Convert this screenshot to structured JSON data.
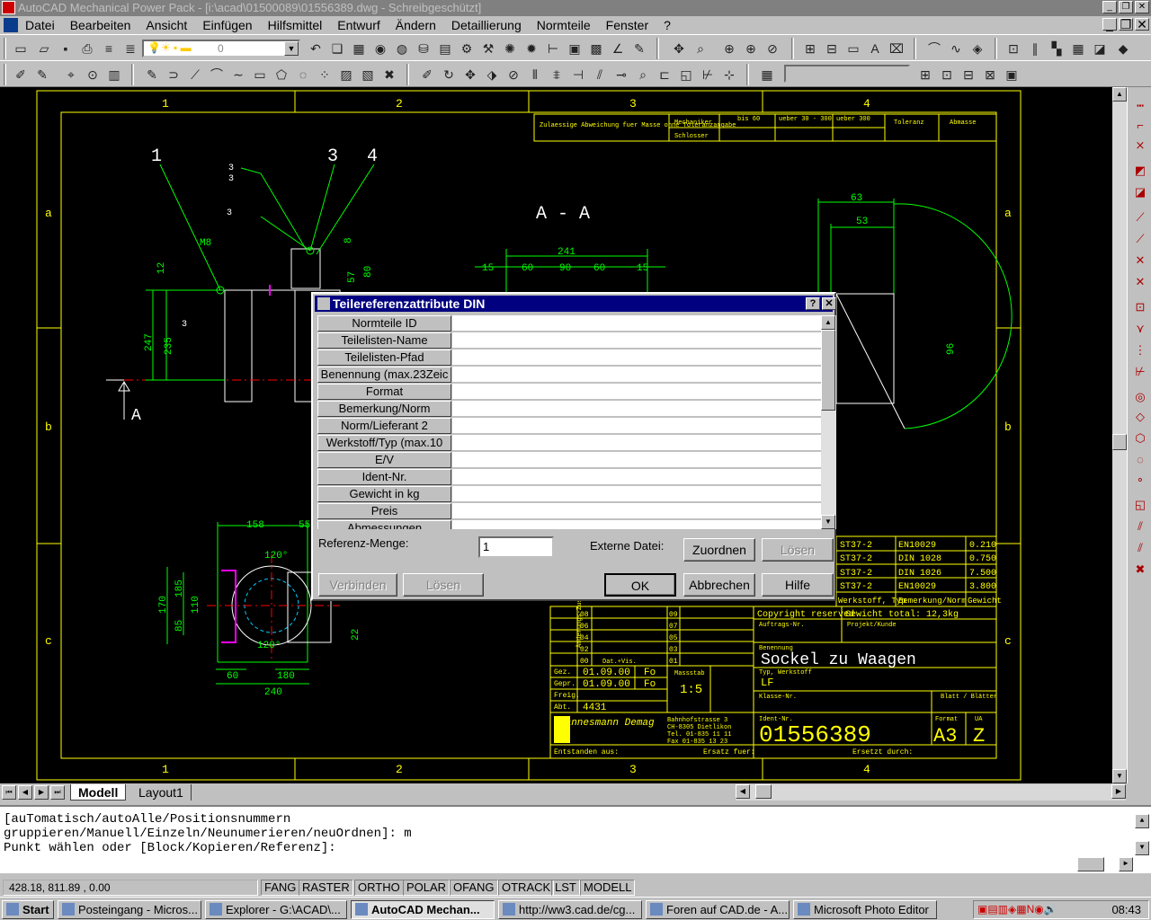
{
  "window": {
    "title": "AutoCAD Mechanical Power Pack - [i:\\acad\\01500089\\01556389.dwg - Schreibgeschützt]"
  },
  "menu": [
    "Datei",
    "Bearbeiten",
    "Ansicht",
    "Einfügen",
    "Hilfsmittel",
    "Entwurf",
    "Ändern",
    "Detaillierung",
    "Normteile",
    "Fenster",
    "?"
  ],
  "layer": {
    "value": "0"
  },
  "drawing": {
    "col_numbers": [
      "1",
      "2",
      "3",
      "4"
    ],
    "row_letters": [
      "a",
      "b",
      "c"
    ],
    "section_title": "A - A",
    "tolerance_header": [
      "Zulaessige Abweichung fuer Masse ohne Toleranzangabe",
      "Mechaniker",
      "Schlosser",
      "bis 60",
      "ueber 30 - 300",
      "ueber 300",
      "Toleranz",
      "Abmasse"
    ],
    "dims": [
      "M8",
      "12",
      "247",
      "235",
      "57",
      "80",
      "8",
      "241",
      "15",
      "60",
      "90",
      "60",
      "15",
      "63",
      "53",
      "96",
      "158",
      "55",
      "185",
      "170",
      "110",
      "85",
      "60",
      "180",
      "240",
      "22"
    ],
    "balloons": [
      "1",
      "3",
      "4"
    ],
    "bom": [
      [
        "ST37-2",
        "EN10029",
        "0.210"
      ],
      [
        "ST37-2",
        "DIN 1028",
        "0.750"
      ],
      [
        "ST37-2",
        "DIN 1026",
        "7.500"
      ],
      [
        "ST37-2",
        "EN10029",
        "3.800"
      ]
    ],
    "bom_header": [
      "Werkstoff, Typ",
      "Bemerkung/Norm",
      "Gewicht"
    ],
    "copyright": "Copyright reserved",
    "weight": "Gewicht total: 12,3kg",
    "auftrags": "Auftrags-Nr.",
    "projekt": "Projekt/Kunde",
    "benennung_label": "Benennung",
    "title": "Sockel zu Waagen",
    "typ_label": "Typ, Werkstoff",
    "typ": "LF",
    "klasse": "Klasse-Nr.",
    "blatt": "Blatt / Blätter",
    "ident_label": "Ident-Nr.",
    "ident": "01556389",
    "format_label": "Format",
    "format": "A3",
    "ua_label": "UA",
    "ua": "Z",
    "scale_label": "Massstab",
    "scale": "1:5",
    "company": "Mannesmann Demag",
    "address": [
      "Bahnhofstrasse 3",
      "CH-8305 Dietlikon",
      "Tel. 01-835 11 11",
      "Fax 01-835 13 23"
    ],
    "rev_label": "Änderungs-Zustand",
    "rev_rows": [
      "09",
      "08",
      "07",
      "06",
      "05",
      "04",
      "03",
      "02",
      "01",
      "00"
    ],
    "rev00": "Dat.+Vis.",
    "gez": "Gez.",
    "gepr": "Gepr.",
    "freig": "Freig.",
    "abt": "Abt.",
    "date1": "01.09.00",
    "date2": "01.09.00",
    "vis1": "Fo",
    "vis2": "Fo",
    "abt_val": "4431",
    "entstanden": "Entstanden aus:",
    "ersatz": "Ersatz fuer:",
    "ersetzt": "Ersetzt durch:"
  },
  "dialog": {
    "title": "Teilereferenzattribute DIN",
    "fields": [
      "Normteile ID",
      "Teilelisten-Name",
      "Teilelisten-Pfad",
      "Benennung (max.23Zeic",
      "Format",
      "Bemerkung/Norm",
      "Norm/Lieferant 2",
      "Werkstoff/Typ (max.10",
      "E/V",
      "Ident-Nr.",
      "Gewicht in kg",
      "Preis",
      "Abmessungen"
    ],
    "ref_label": "Referenz-Menge:",
    "ref_value": "1",
    "ext_label": "Externe Datei:",
    "zuordnen": "Zuordnen",
    "loesen1": "Lösen",
    "verbinden": "Verbinden",
    "loesen2": "Lösen",
    "ok": "OK",
    "abbrechen": "Abbrechen",
    "hilfe": "Hilfe"
  },
  "tabs": {
    "modell": "Modell",
    "layout1": "Layout1"
  },
  "command": [
    "[auTomatisch/autoAlle/Positionsnummern",
    "gruppieren/Manuell/Einzeln/Neunumerieren/neuOrdnen]: m",
    "Punkt wählen oder [Block/Kopieren/Referenz]:"
  ],
  "status": {
    "coords": "428.18, 811.89 , 0.00",
    "buttons": [
      "FANG",
      "RASTER",
      "ORTHO",
      "POLAR",
      "OFANG",
      "OTRACK",
      "LST",
      "MODELL"
    ]
  },
  "taskbar": {
    "start": "Start",
    "tasks": [
      "Posteingang - Micros...",
      "Explorer - G:\\ACAD\\...",
      "AutoCAD Mechan...",
      "http://ww3.cad.de/cg...",
      "Foren auf CAD.de - A...",
      "Microsoft Photo Editor"
    ],
    "clock": "08:43"
  }
}
